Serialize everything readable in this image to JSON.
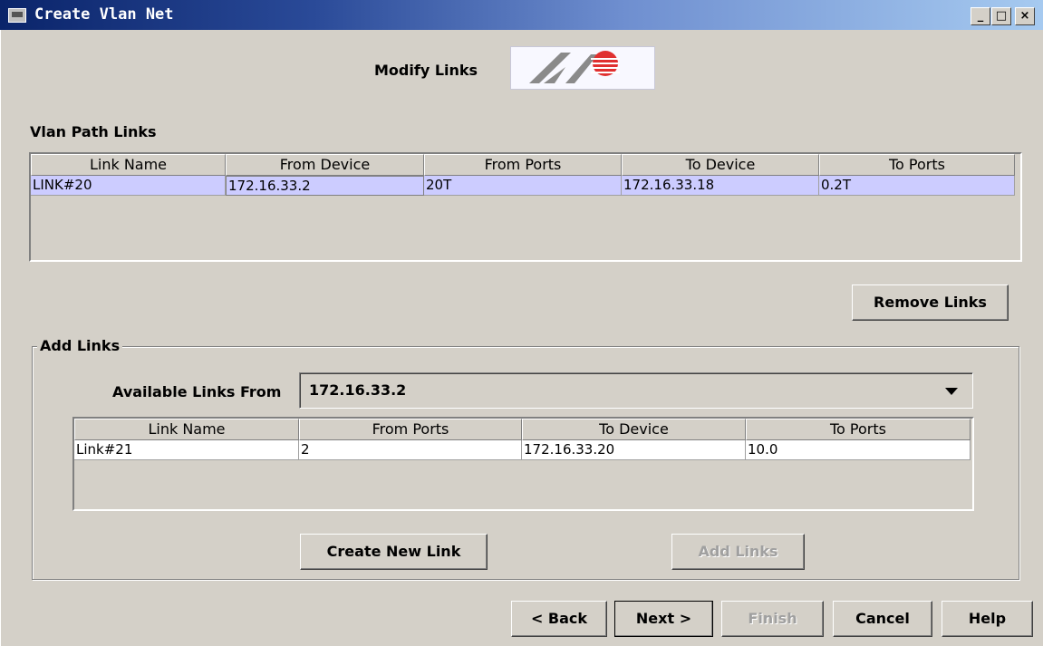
{
  "window": {
    "title": "Create Vlan Net",
    "controls": [
      "_",
      "□",
      "×"
    ]
  },
  "header": {
    "heading": "Modify Links"
  },
  "path_links": {
    "section_label": "Vlan Path Links",
    "columns": [
      "Link Name",
      "From Device",
      "From Ports",
      "To Device",
      "To Ports"
    ],
    "rows": [
      [
        "LINK#20",
        "172.16.33.2",
        "20T",
        "172.16.33.18",
        "0.2T"
      ]
    ],
    "remove_label": "Remove Links"
  },
  "add_links": {
    "group_label": "Add Links",
    "available_label": "Available Links From",
    "available_value": "172.16.33.2",
    "columns": [
      "Link Name",
      "From Ports",
      "To Device",
      "To Ports"
    ],
    "rows": [
      [
        "Link#21",
        "2",
        "172.16.33.20",
        "10.0"
      ]
    ],
    "create_label": "Create New Link",
    "add_label": "Add Links"
  },
  "footer": {
    "back": "< Back",
    "next": "Next >",
    "finish": "Finish",
    "cancel": "Cancel",
    "help": "Help"
  },
  "colors": {
    "selection": "#ccccff",
    "title_start": "#0a246a",
    "title_end": "#a6caf0"
  },
  "icons": [
    "window-app-icon",
    "company-logo"
  ]
}
